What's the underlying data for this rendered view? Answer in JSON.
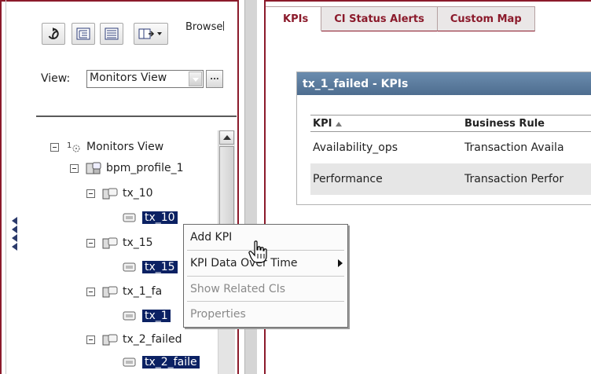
{
  "toolbar": {
    "refresh_icon": "refresh-icon",
    "tree_view_icon": "tree-view-icon",
    "list_view_icon": "list-view-icon",
    "mode_dropdown_icon": "mode-dropdown-icon",
    "browse_label": "Browse"
  },
  "view": {
    "label": "View:",
    "selected": "Monitors View",
    "more_button": "..."
  },
  "tree": {
    "root": "Monitors View",
    "root_icon_prefix": "1",
    "profile": "bpm_profile_1",
    "nodes": [
      {
        "label": "tx_10",
        "child": "tx_10"
      },
      {
        "label": "tx_15",
        "child": "tx_15"
      },
      {
        "label": "tx_1_fa",
        "child": "tx_1"
      },
      {
        "label": "tx_2_failed",
        "child": "tx_2_faile"
      }
    ]
  },
  "tabs": [
    {
      "label": "KPIs",
      "active": true
    },
    {
      "label": "CI Status Alerts",
      "active": false
    },
    {
      "label": "Custom Map",
      "active": false
    }
  ],
  "panel": {
    "title": "tx_1_failed - KPIs",
    "columns": [
      "KPI",
      "Business Rule"
    ],
    "rows": [
      {
        "kpi": "Availability_ops",
        "rule": "Transaction Availa"
      },
      {
        "kpi": "Performance",
        "rule": "Transaction Perfor"
      }
    ]
  },
  "context_menu": {
    "items": [
      {
        "label": "Add KPI",
        "enabled": true
      },
      {
        "label": "KPI Data Over Time",
        "enabled": true,
        "submenu": true
      },
      {
        "label": "Show Related CIs",
        "enabled": false
      },
      {
        "label": "Properties",
        "enabled": false
      }
    ]
  },
  "colors": {
    "accent_border": "#8b1a2b",
    "selection": "#0b2163",
    "panel_header": "#5a7a9c"
  }
}
